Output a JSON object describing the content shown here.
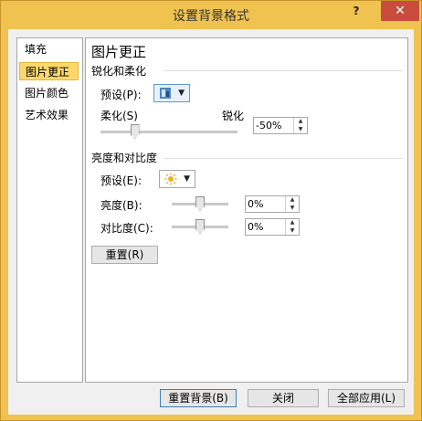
{
  "window": {
    "title": "设置背景格式",
    "help_glyph": "?",
    "close_glyph": "✕"
  },
  "nav": {
    "items": [
      {
        "label": "填充"
      },
      {
        "label": "图片更正",
        "active": true
      },
      {
        "label": "图片颜色"
      },
      {
        "label": "艺术效果"
      }
    ]
  },
  "panel": {
    "title": "图片更正",
    "sharpen": {
      "section_title": "锐化和柔化",
      "preset_label": "预设(P):",
      "soften_label": "柔化(S)",
      "sharpen_label": "锐化",
      "value": "-50%",
      "slider_fraction": 0.25
    },
    "brightness": {
      "section_title": "亮度和对比度",
      "preset_label": "预设(E):",
      "brightness_label": "亮度(B):",
      "brightness_value": "0%",
      "brightness_fraction": 0.5,
      "contrast_label": "对比度(C):",
      "contrast_value": "0%",
      "contrast_fraction": 0.5
    },
    "reset_label": "重置(R)"
  },
  "footer": {
    "reset_background": "重置背景(B)",
    "close": "关闭",
    "apply_all": "全部应用(L)"
  },
  "colors": {
    "accent": "#f0c350",
    "selected_nav": "#fcd86a",
    "close_button": "#c94c3d"
  }
}
